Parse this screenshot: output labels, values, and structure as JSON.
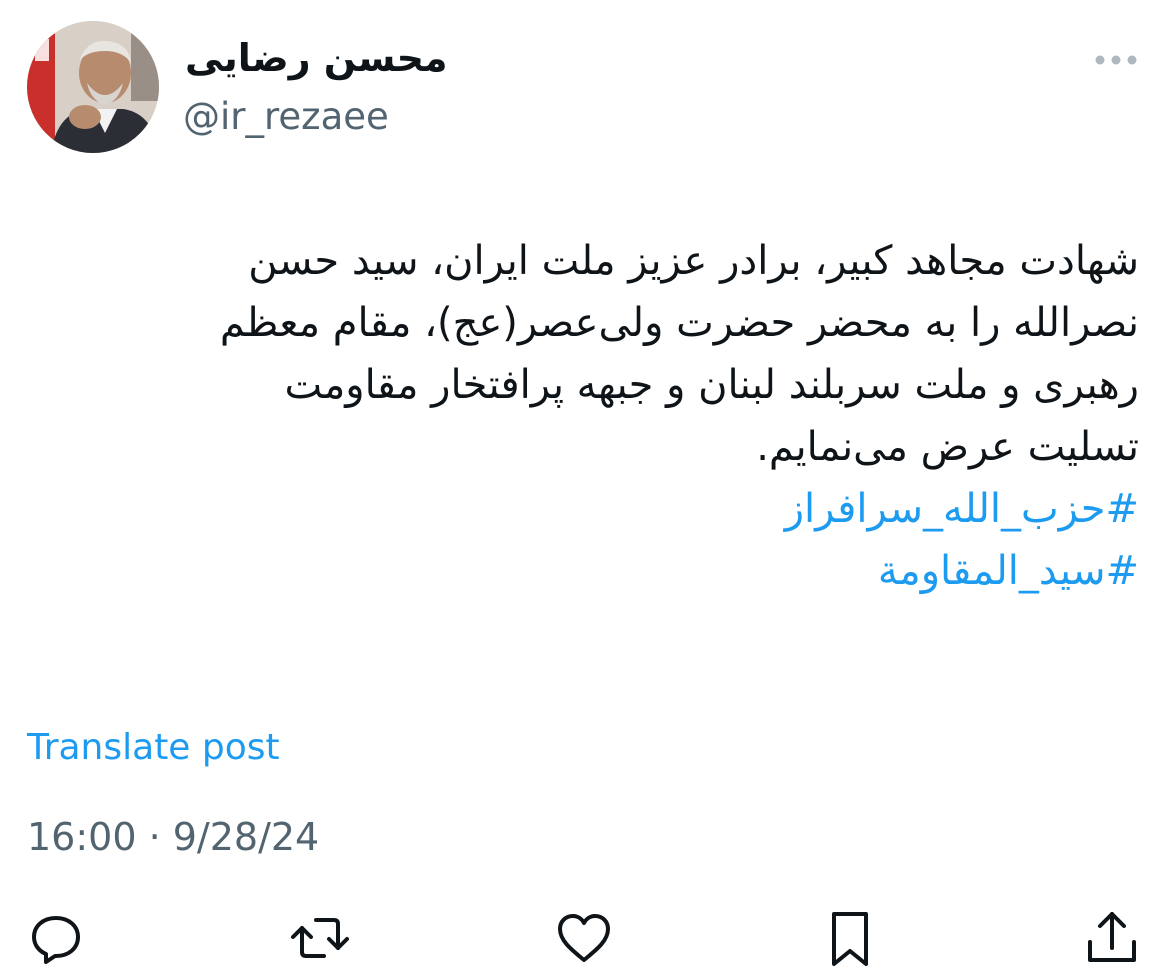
{
  "author": {
    "display_name": "محسن رضایی",
    "handle": "@ir_rezaee"
  },
  "tweet": {
    "lines": [
      "شهادت مجاهد کبیر، برادر عزیز ملت ایران، سید حسن",
      "نصرالله را به محضر حضرت ولی‌عصر(عج)، مقام معظم",
      "رهبری و ملت سربلند لبنان و جبهه پرافتخار مقاومت",
      "تسلیت عرض می‌نمایم."
    ],
    "hashtags": [
      "#حزب_الله_سرافراز",
      "#سید_المقاومة"
    ]
  },
  "translate_label": "Translate post",
  "timestamp": "16:00 · 9/28/24",
  "actions": {
    "reply_icon": "reply-icon",
    "repost_icon": "repost-icon",
    "like_icon": "heart-icon",
    "bookmark_icon": "bookmark-icon",
    "share_icon": "share-icon"
  },
  "colors": {
    "link": "#1d9bf0",
    "secondary_text": "#536471",
    "primary_text": "#0f1419"
  }
}
